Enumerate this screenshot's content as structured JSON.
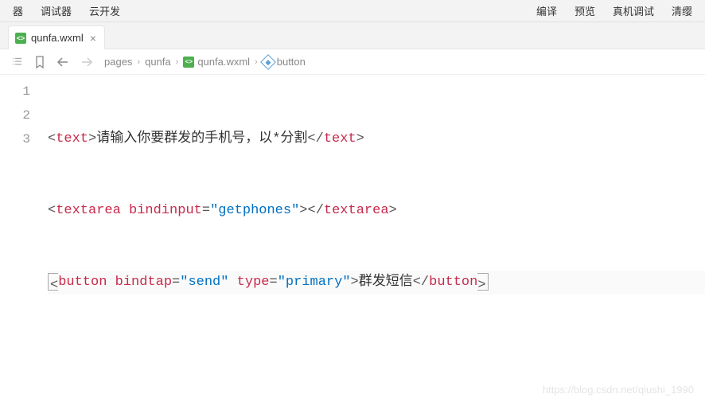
{
  "menu": {
    "left": [
      "器",
      "调试器",
      "云开发"
    ],
    "right": [
      "编译",
      "预览",
      "真机调试",
      "清缨"
    ]
  },
  "tabs": [
    {
      "label": "qunfa.wxml"
    }
  ],
  "breadcrumb": [
    {
      "label": "pages"
    },
    {
      "label": "qunfa"
    },
    {
      "label": "qunfa.wxml",
      "icon": "wxml-file-icon"
    },
    {
      "label": "button",
      "icon": "element-icon"
    }
  ],
  "code": {
    "lines": [
      {
        "n": "1",
        "tag": "text",
        "text": "请输入你要群发的手机号，以*分割"
      },
      {
        "n": "2",
        "tag": "textarea",
        "attrs": [
          {
            "name": "bindinput",
            "value": "getphones"
          }
        ]
      },
      {
        "n": "3",
        "tag": "button",
        "attrs": [
          {
            "name": "bindtap",
            "value": "send"
          },
          {
            "name": "type",
            "value": "primary"
          }
        ],
        "text": "群发短信"
      }
    ]
  },
  "watermark": "https://blog.csdn.net/qiushi_1990"
}
